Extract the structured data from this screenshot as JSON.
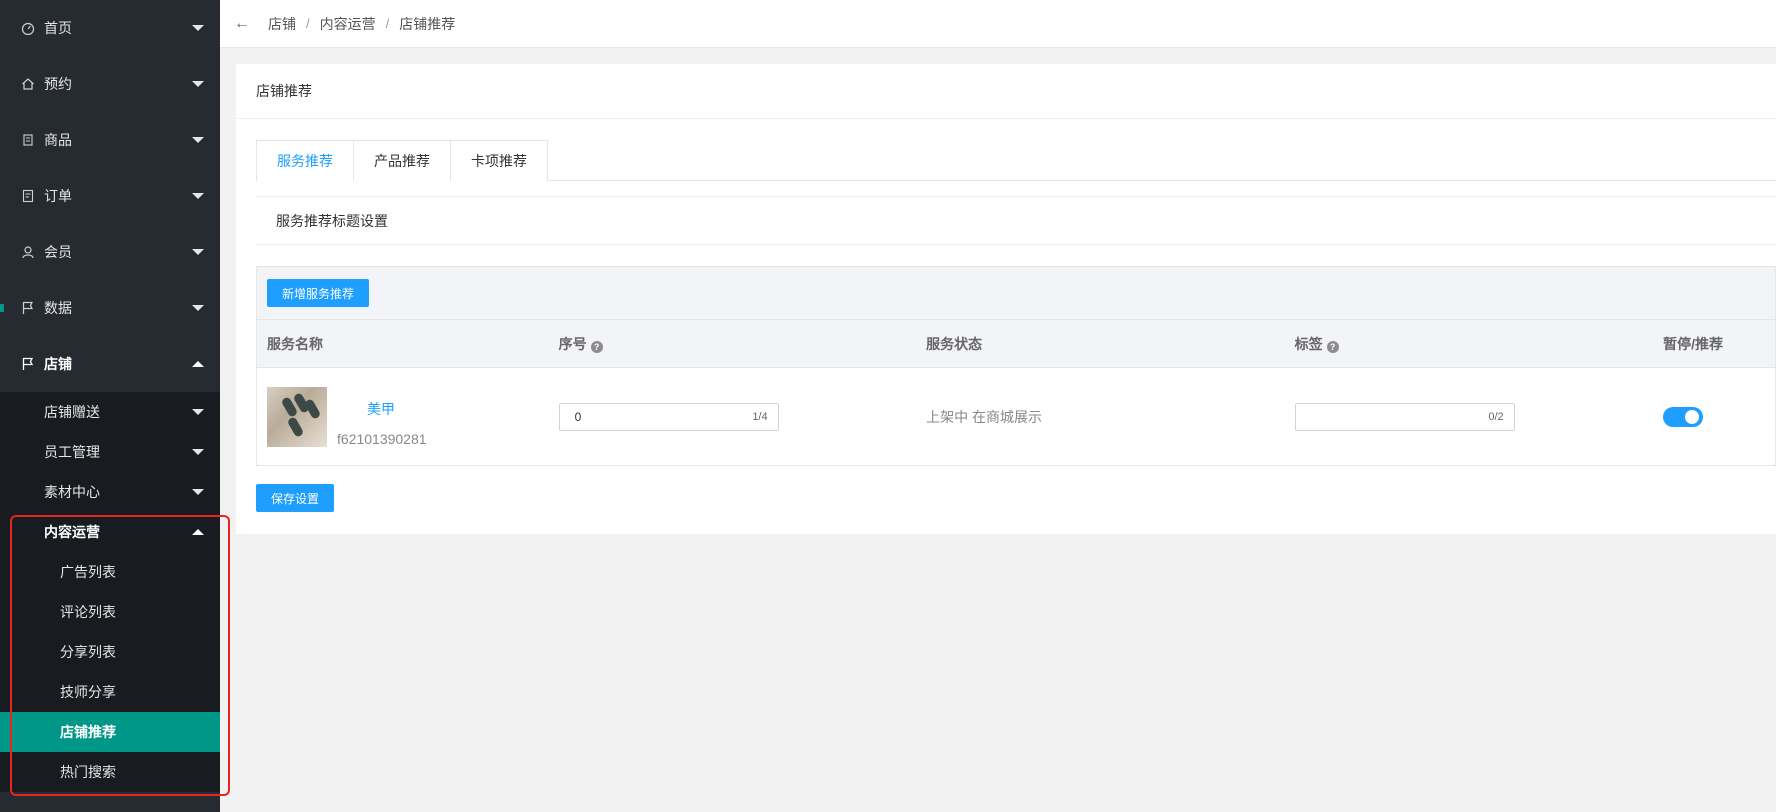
{
  "sidebar": {
    "top_items": [
      {
        "label": "首页",
        "icon": "gauge-icon"
      },
      {
        "label": "预约",
        "icon": "home-icon"
      },
      {
        "label": "商品",
        "icon": "goods-icon"
      },
      {
        "label": "订单",
        "icon": "order-icon"
      },
      {
        "label": "会员",
        "icon": "member-icon"
      },
      {
        "label": "数据",
        "icon": "flag-icon"
      },
      {
        "label": "店铺",
        "icon": "flag-icon"
      }
    ],
    "sub_items": [
      "店铺赠送",
      "员工管理",
      "素材中心",
      "内容运营"
    ],
    "content_ops_items": [
      "广告列表",
      "评论列表",
      "分享列表",
      "技师分享",
      "店铺推荐",
      "热门搜索"
    ],
    "active_item": "店铺推荐"
  },
  "breadcrumb": [
    "店铺",
    "内容运营",
    "店铺推荐"
  ],
  "card": {
    "title": "店铺推荐",
    "tabs": [
      "服务推荐",
      "产品推荐",
      "卡项推荐"
    ],
    "active_tab": "服务推荐",
    "subtitle": "服务推荐标题设置",
    "add_button": "新增服务推荐",
    "save_button": "保存设置"
  },
  "table": {
    "columns": [
      "服务名称",
      "序号",
      "服务状态",
      "标签",
      "暂停/推荐"
    ],
    "rows": [
      {
        "service_name": "美甲",
        "service_code": "f62101390281",
        "order_value": "0",
        "order_count": "1/4",
        "status": "上架中 在商城展示",
        "tag_value": "",
        "tag_count": "0/2",
        "recommend_on": true
      }
    ]
  },
  "colors": {
    "sidebar_bg": "#262a31",
    "active_teal": "#009688",
    "primary_blue": "#1e9fff",
    "highlight_red": "#e52621"
  }
}
